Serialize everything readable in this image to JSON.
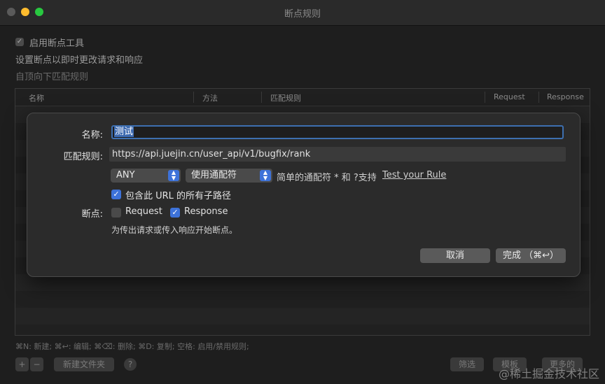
{
  "window": {
    "title": "断点规则"
  },
  "background": {
    "enable_label": "启用断点工具",
    "desc": "设置断点以即时更改请求和响应",
    "order_hint": "自顶向下匹配规则",
    "columns": [
      "名称",
      "方法",
      "匹配规则",
      "Request",
      "Response"
    ],
    "shortcuts": "⌘N: 新建; ⌘↩: 编辑; ⌘⌫: 删除; ⌘D: 复制; 空格: 启用/禁用规则;",
    "add_label": "+",
    "remove_label": "−",
    "new_folder_label": "新建文件夹",
    "help_label": "?",
    "filter_label": "筛选",
    "template_label": "模板",
    "more_label": "更多的"
  },
  "dialog": {
    "name_label": "名称:",
    "name_value": "测试",
    "match_label": "匹配规则:",
    "match_value": "https://api.juejin.cn/user_api/v1/bugfix/rank",
    "method_value": "ANY",
    "wildcard_value": "使用通配符",
    "wildcard_hint": "简单的通配符 * 和 ?支持",
    "test_link": "Test your Rule",
    "include_subpaths_label": "包含此 URL 的所有子路径",
    "include_subpaths_checked": true,
    "breakpoint_label": "断点:",
    "request_label": "Request",
    "request_checked": false,
    "response_label": "Response",
    "response_checked": true,
    "note": "为传出请求或传入响应开始断点。",
    "cancel_label": "取消",
    "done_label": "完成 （⌘↩）"
  },
  "watermark": "@稀土掘金技术社区",
  "colors": {
    "accent": "#3d72d9",
    "window_bg": "#1e1e1e",
    "dialog_bg": "#2b2b2b"
  }
}
